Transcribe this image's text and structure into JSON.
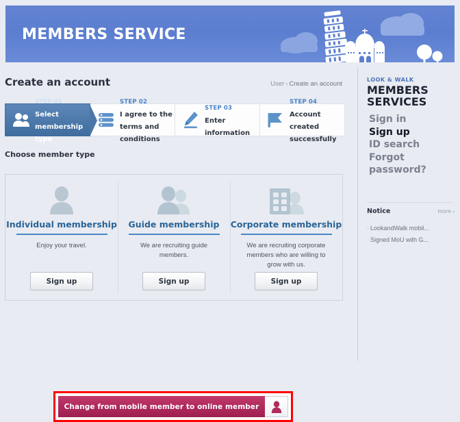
{
  "header": {
    "title": "MEMBERS SERVICE",
    "art": [
      "leaning-tower-icon",
      "domed-church-icon",
      "cloud-icon",
      "tree-icon"
    ],
    "bg_color": "#5c7ed0"
  },
  "page": {
    "title": "Create an account",
    "breadcrumb": {
      "root": "User",
      "separator": "›",
      "current": "Create an account"
    }
  },
  "steps": [
    {
      "num": "STEP 01",
      "label": "Select membership type",
      "icon": "users-icon",
      "active": true
    },
    {
      "num": "STEP 02",
      "label": "I agree to the terms and conditions",
      "icon": "checklist-icon",
      "active": false
    },
    {
      "num": "STEP 03",
      "label": "Enter information",
      "icon": "pencil-icon",
      "active": false
    },
    {
      "num": "STEP 04",
      "label": "Account created successfully",
      "icon": "flag-icon",
      "active": false
    }
  ],
  "main": {
    "choose_label": "Choose member type",
    "cards": [
      {
        "title": "Individual membership",
        "desc": "Enjoy your travel.",
        "button": "Sign up",
        "icon": "single-person-icon"
      },
      {
        "title": "Guide membership",
        "desc": "We are recruiting guide members.",
        "button": "Sign up",
        "icon": "two-people-icon"
      },
      {
        "title": "Corporate membership",
        "desc": "We are recruiting corporate members who are willing to grow with us.",
        "button": "Sign up",
        "icon": "building-person-icon"
      }
    ],
    "cta": {
      "label": "Change from mobile member to online member",
      "icon": "person-badge-icon",
      "highlight_color": "#ff0000",
      "button_color": "#b02b5e"
    }
  },
  "sidebar": {
    "eyebrow": "LOOK & WALK",
    "title": "MEMBERS SERVICES",
    "nav": [
      {
        "label": "Sign in",
        "current": false
      },
      {
        "label": "Sign up",
        "current": true
      },
      {
        "label": "ID search",
        "current": false
      },
      {
        "label": "Forgot password?",
        "current": false
      }
    ],
    "notice": {
      "title": "Notice",
      "more": "more ›",
      "items": [
        "LookandWalk mobil...",
        "Signed MoU with G..."
      ]
    }
  },
  "colors": {
    "accent_blue": "#4a86c8",
    "link_blue": "#2a6496",
    "page_bg": "#e8ebf2"
  }
}
